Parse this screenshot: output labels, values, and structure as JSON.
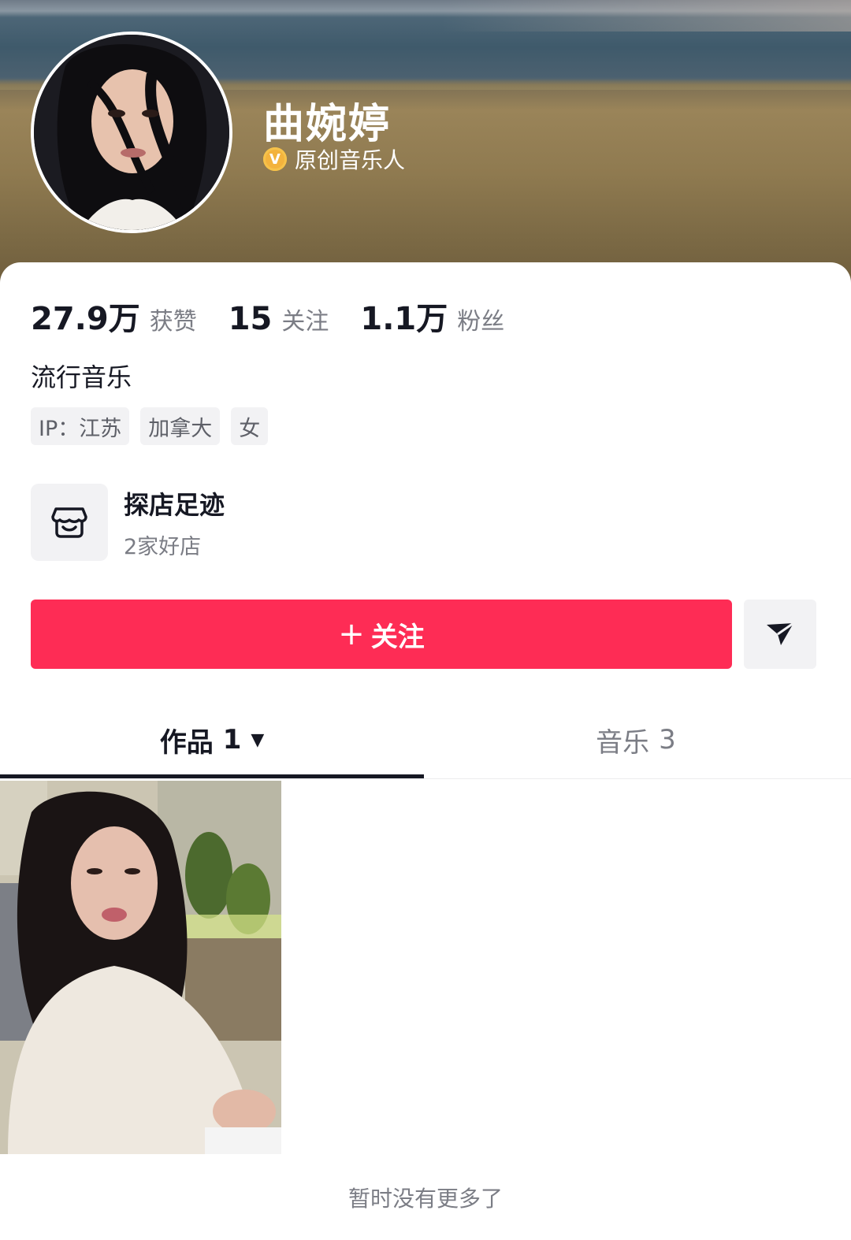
{
  "profile": {
    "name": "曲婉婷",
    "verification_label": "原创音乐人",
    "verified_icon": "v-badge-icon",
    "bio": "流行音乐",
    "tags": [
      "IP：江苏",
      "加拿大",
      "女"
    ]
  },
  "stats": [
    {
      "number": "27.9万",
      "label": "获赞"
    },
    {
      "number": "15",
      "label": "关注"
    },
    {
      "number": "1.1万",
      "label": "粉丝"
    }
  ],
  "shop": {
    "title": "探店足迹",
    "subtitle": "2家好店",
    "icon": "store-icon"
  },
  "actions": {
    "follow_plus": "+",
    "follow_label": "关注",
    "message_icon": "send-arrow-icon"
  },
  "tabs": [
    {
      "label": "作品",
      "count": "1",
      "active": true
    },
    {
      "label": "音乐",
      "count": "3",
      "active": false
    }
  ],
  "footer": {
    "no_more": "暂时没有更多了"
  },
  "colors": {
    "accent": "#fe2c55",
    "badge": "#f3b33d"
  }
}
